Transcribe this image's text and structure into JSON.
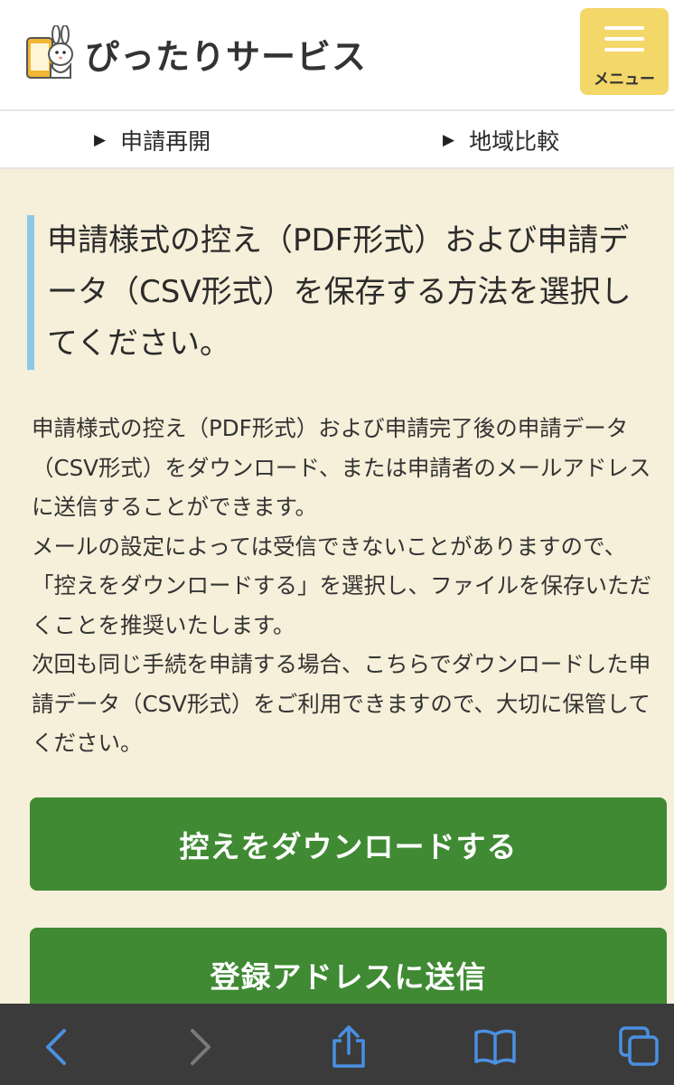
{
  "header": {
    "app_name": "ぴったりサービス",
    "menu_label": "メニュー"
  },
  "subnav": {
    "items": [
      {
        "label": "申請再開"
      },
      {
        "label": "地域比較"
      }
    ]
  },
  "main": {
    "headline": "申請様式の控え（PDF形式）および申請データ（CSV形式）を保存する方法を選択してください。",
    "paragraphs": [
      "申請様式の控え（PDF形式）および申請完了後の申請データ（CSV形式）をダウンロード、または申請者のメールアドレスに送信することができます。",
      "メールの設定によっては受信できないことがありますので、「控えをダウンロードする」を選択し、ファイルを保存いただくことを推奨いたします。",
      "次回も同じ手続を申請する場合、こちらでダウンロードした申請データ（CSV形式）をご利用できますので、大切に保管してください。"
    ],
    "download_button": "控えをダウンロードする",
    "send_button": "登録アドレスに送信"
  },
  "browser_toolbar": {
    "icons": [
      "back-icon",
      "forward-icon",
      "share-icon",
      "bookmarks-icon",
      "tabs-icon"
    ]
  },
  "colors": {
    "page_background": "#f6efd9",
    "menu_button": "#f3d769",
    "primary_button": "#3f8a33",
    "headline_accent": "#8ec8e8",
    "browser_bar": "#3b3b3b",
    "browser_icon_active": "#4a90e2",
    "browser_icon_inactive": "#7a7a7a"
  }
}
